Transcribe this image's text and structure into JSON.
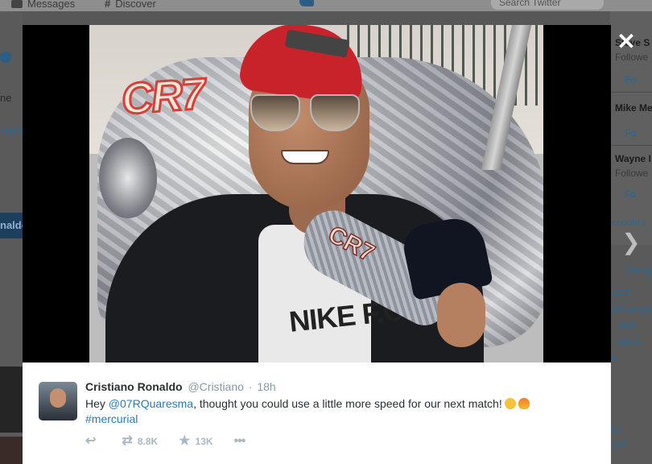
{
  "topbar": {
    "messages_label": "Messages",
    "discover_label": "Discover",
    "search_placeholder": "Search Twitter"
  },
  "left_partial": {
    "text_1": "ne",
    "link_1": "om/te",
    "name_band": "naldo"
  },
  "right_partial": {
    "users": [
      {
        "name": "Steve S",
        "sub": "Followe",
        "follow": "Fo"
      },
      {
        "name": "Mike Me",
        "sub": "",
        "follow": "Fo"
      },
      {
        "name": "Wayne I",
        "sub": "Followe",
        "follow": "Fo"
      }
    ],
    "accounts_link": "ccounts",
    "trends_change": "Chang",
    "trends": [
      "aGP",
      "erNumber",
      "Lubitz",
      "ndiana",
      "e"
    ],
    "trends_bottom": [
      "ge",
      "erhi"
    ]
  },
  "modal": {
    "close_icon": "close-icon",
    "next_icon": "chevron-right-icon",
    "photo": {
      "car_text": "CR7",
      "boot_text": "CR7",
      "shirt_text": "NIKE F.C."
    }
  },
  "tweet": {
    "fullname": "Cristiano Ronaldo",
    "screen_name": "@Cristiano",
    "separator": "·",
    "time": "18h",
    "text_prefix": "Hey ",
    "mention": "@07RQuaresma",
    "text_body": ", thought you could use a little more speed for our next match!",
    "hashtag": "#mercurial",
    "emojis": [
      "winking-face",
      "fire"
    ],
    "actions": {
      "reply_icon": "reply-icon",
      "retweet_icon": "retweet-icon",
      "retweet_count": "8.8K",
      "favorite_icon": "star-icon",
      "favorite_count": "13K",
      "more_icon": "more-icon"
    },
    "colors": {
      "link": "#2b7bb9",
      "meta": "#8899a6",
      "action": "#aab8c2"
    }
  }
}
